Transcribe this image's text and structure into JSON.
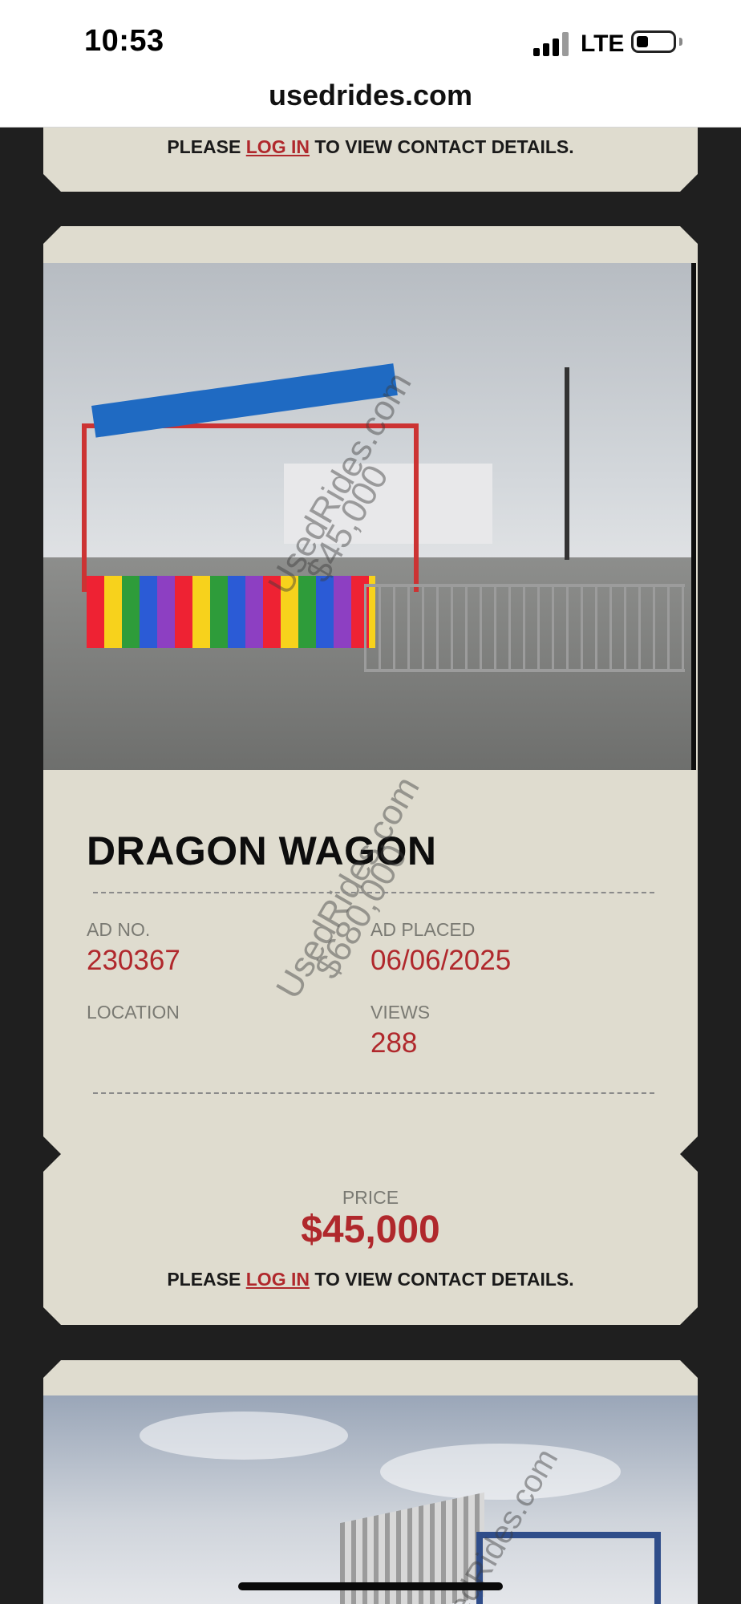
{
  "status_bar": {
    "time": "10:53",
    "network": "LTE"
  },
  "browser": {
    "url": "usedrides.com"
  },
  "contact_notice": {
    "prefix": "PLEASE",
    "link": "LOG IN",
    "suffix": "TO VIEW CONTACT DETAILS."
  },
  "listing": {
    "title": "DRAGON WAGON",
    "ad_no_label": "AD NO.",
    "ad_no": "230367",
    "ad_placed_label": "AD PLACED",
    "ad_placed": "06/06/2025",
    "location_label": "LOCATION",
    "location": "",
    "views_label": "VIEWS",
    "views": "288",
    "price_label": "PRICE",
    "price": "$45,000",
    "photo_watermark": [
      "UsedRides.com",
      "$45,000"
    ],
    "overlay_watermark": [
      "UsedRides.com",
      "$680,000"
    ]
  },
  "next_listing": {
    "photo_watermark": "UsedRides.com"
  },
  "colors": {
    "accent": "#b0282c",
    "card_bg": "#dfdccf",
    "page_bg": "#1f1f1f"
  }
}
